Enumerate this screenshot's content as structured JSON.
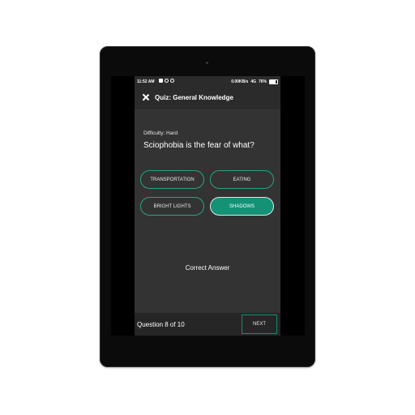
{
  "status_bar": {
    "time": "11:52 AM",
    "network_speed": "0.00KB/s",
    "network_type": "4G",
    "battery": "76%"
  },
  "app_bar": {
    "close_icon": "close-icon",
    "title": "Quiz: General Knowledge"
  },
  "quiz": {
    "difficulty": "Difficulty: Hard",
    "question": "Sciophobia is the fear of what?",
    "answers": [
      {
        "label": "TRANSPORTATION",
        "selected": false
      },
      {
        "label": "EATING",
        "selected": false
      },
      {
        "label": "BRIGHT LIGHTS",
        "selected": false
      },
      {
        "label": "SHADOWS",
        "selected": true
      }
    ],
    "result": "Correct Answer"
  },
  "footer": {
    "progress": "Question 8 of 10",
    "next_label": "NEXT"
  },
  "colors": {
    "accent": "#139276",
    "accent_border": "#28a383",
    "background": "#333333",
    "bar": "#2b2b2b"
  }
}
